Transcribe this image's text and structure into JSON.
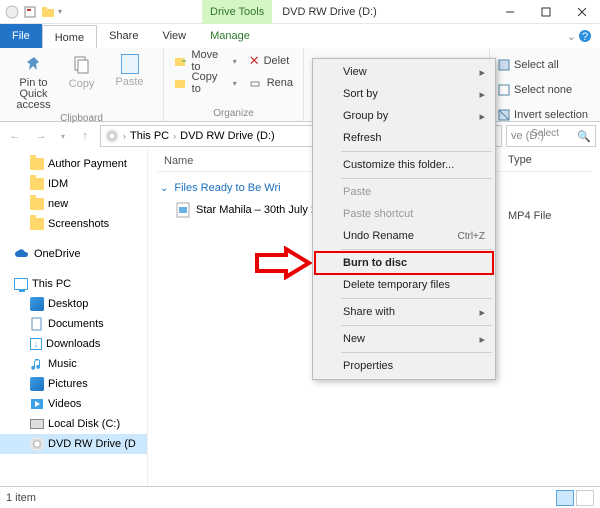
{
  "titlebar": {
    "tool_tab": "Drive Tools",
    "title": "DVD RW Drive (D:)"
  },
  "tabs": {
    "file": "File",
    "home": "Home",
    "share": "Share",
    "view": "View",
    "manage": "Manage"
  },
  "ribbon": {
    "clipboard": {
      "pin": "Pin to Quick access",
      "copy": "Copy",
      "paste": "Paste",
      "label": "Clipboard"
    },
    "organize": {
      "move": "Move to",
      "copy": "Copy to",
      "delete": "Delet",
      "rename": "Rena",
      "label": "Organize"
    },
    "select": {
      "all": "Select all",
      "none": "Select none",
      "invert": "Invert selection",
      "label": "Select"
    }
  },
  "breadcrumb": {
    "pc": "This PC",
    "drive": "DVD RW Drive (D:)"
  },
  "search_placeholder": "ve (D:)",
  "tree": {
    "authorpayments": "Author Payment",
    "idm": "IDM",
    "new": "new",
    "screenshots": "Screenshots",
    "onedrive": "OneDrive",
    "thispc": "This PC",
    "desktop": "Desktop",
    "documents": "Documents",
    "downloads": "Downloads",
    "music": "Music",
    "pictures": "Pictures",
    "videos": "Videos",
    "localdisk": "Local Disk (C:)",
    "dvd": "DVD RW Drive (D"
  },
  "columns": {
    "name": "Name",
    "type": "Type"
  },
  "group_header": "Files Ready to Be Wri",
  "file_row": {
    "name": "Star Mahila – 30th July 20",
    "type": "MP4 File"
  },
  "ctx": {
    "view": "View",
    "sortby": "Sort by",
    "groupby": "Group by",
    "refresh": "Refresh",
    "customize": "Customize this folder...",
    "paste": "Paste",
    "paste_shortcut": "Paste shortcut",
    "undo": "Undo Rename",
    "undo_kb": "Ctrl+Z",
    "burn": "Burn to disc",
    "deltemp": "Delete temporary files",
    "sharewith": "Share with",
    "new": "New",
    "properties": "Properties"
  },
  "status": "1 item"
}
